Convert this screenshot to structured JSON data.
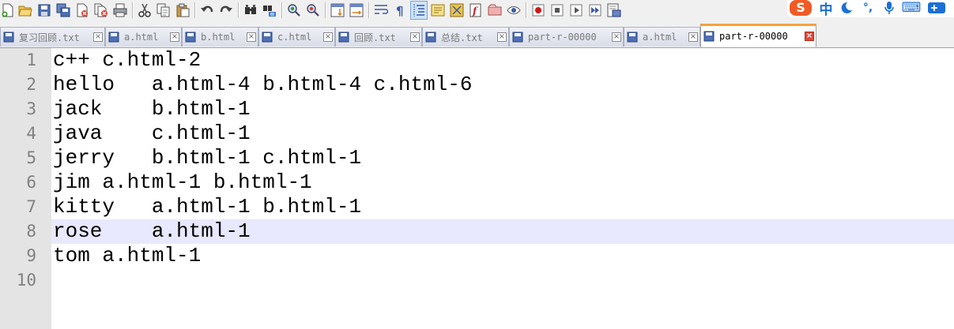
{
  "toolbar": {
    "icons": [
      "new-file-icon",
      "open-file-icon",
      "save-icon",
      "save-all-icon",
      "close-icon",
      "close-all-icon",
      "print-icon",
      "cut-icon",
      "copy-icon",
      "paste-icon",
      "undo-icon",
      "redo-icon",
      "find-icon",
      "replace-icon",
      "zoom-in-icon",
      "zoom-out-icon",
      "sync-vertical-icon",
      "sync-horizontal-icon",
      "word-wrap-icon",
      "show-all-chars-icon",
      "indent-guide-icon",
      "doc-map-icon",
      "function-list-icon",
      "folder-workspace-icon",
      "monitoring-icon",
      "macro-record-icon",
      "macro-stop-icon",
      "macro-play-icon",
      "macro-run-multiple-icon",
      "macro-save-icon"
    ]
  },
  "ime": {
    "logo": "S",
    "mode": "中",
    "punct": "°,",
    "keyboard": "⌨"
  },
  "tabs": [
    {
      "label": "复习回顾.txt",
      "active": false,
      "icon": "saved-file-icon"
    },
    {
      "label": "a.html",
      "active": false,
      "icon": "saved-file-icon"
    },
    {
      "label": "b.html",
      "active": false,
      "icon": "saved-file-icon"
    },
    {
      "label": "c.html",
      "active": false,
      "icon": "saved-file-icon"
    },
    {
      "label": "回顾.txt",
      "active": false,
      "icon": "saved-file-icon"
    },
    {
      "label": "总结.txt",
      "active": false,
      "icon": "saved-file-icon"
    },
    {
      "label": "part-r-00000",
      "active": false,
      "icon": "saved-file-icon"
    },
    {
      "label": "a.html",
      "active": false,
      "icon": "saved-file-icon"
    },
    {
      "label": "part-r-00000",
      "active": true,
      "icon": "saved-file-icon"
    }
  ],
  "tab_close_glyph": "×",
  "editor": {
    "current_line": 8,
    "lines": [
      {
        "num": "1",
        "text": "c++ c.html-2"
      },
      {
        "num": "2",
        "text": "hello   a.html-4 b.html-4 c.html-6"
      },
      {
        "num": "3",
        "text": "jack    b.html-1"
      },
      {
        "num": "4",
        "text": "java    c.html-1"
      },
      {
        "num": "5",
        "text": "jerry   b.html-1 c.html-1"
      },
      {
        "num": "6",
        "text": "jim a.html-1 b.html-1"
      },
      {
        "num": "7",
        "text": "kitty   a.html-1 b.html-1"
      },
      {
        "num": "8",
        "text": "rose    a.html-1"
      },
      {
        "num": "9",
        "text": "tom a.html-1"
      },
      {
        "num": "10",
        "text": ""
      }
    ]
  }
}
